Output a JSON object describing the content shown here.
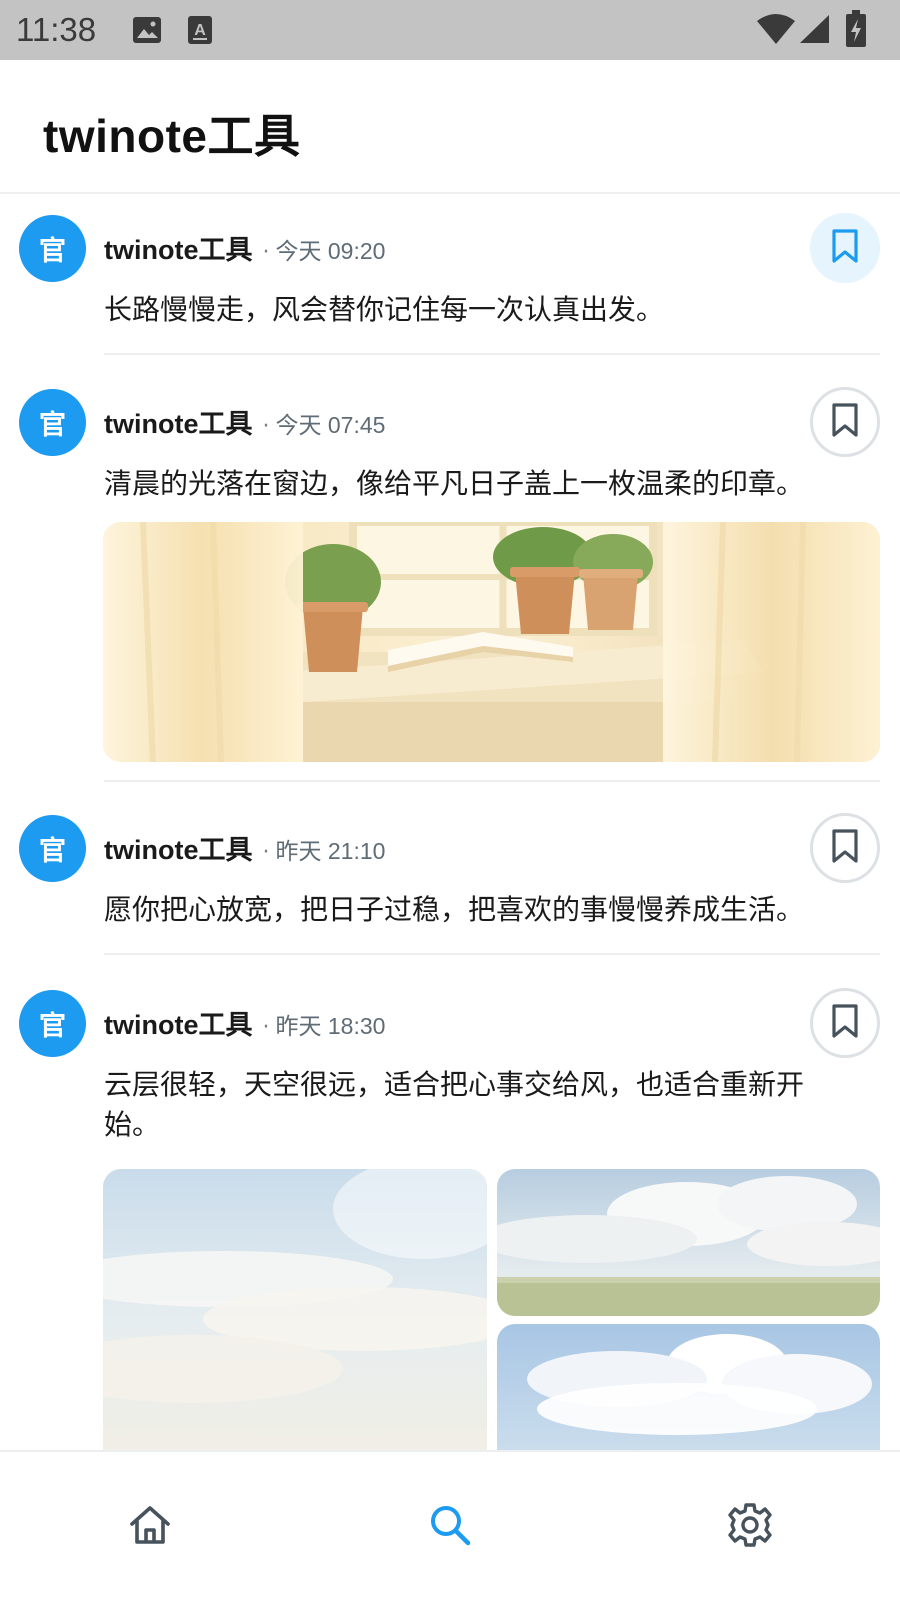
{
  "status_bar": {
    "time": "11:38",
    "icons": [
      "image-icon",
      "a-icon",
      "wifi-icon",
      "signal-icon",
      "battery-icon"
    ]
  },
  "header": {
    "title": "twinote工具"
  },
  "colors": {
    "accent": "#1d9bf0",
    "bookmark_active_bg": "#e6f4fd",
    "meta_gray": "#5f6b75"
  },
  "posts": [
    {
      "avatar_text": "官",
      "author": "twinote工具",
      "separator": "·",
      "time": "今天 09:20",
      "text": "长路慢慢走，风会替你记住每一次认真出发。",
      "bookmarked": true
    },
    {
      "avatar_text": "官",
      "author": "twinote工具",
      "separator": "·",
      "time": "今天 07:45",
      "text": "清晨的光落在窗边，像给平凡日子盖上一枚温柔的印章。",
      "bookmarked": false
    },
    {
      "avatar_text": "官",
      "author": "twinote工具",
      "separator": "·",
      "time": "昨天 21:10",
      "text": "愿你把心放宽，把日子过稳，把喜欢的事慢慢养成生活。",
      "bookmarked": false
    },
    {
      "avatar_text": "官",
      "author": "twinote工具",
      "separator": "·",
      "time": "昨天 18:30",
      "text": "云层很轻，天空很远，适合把心事交给风，也适合重新开始。",
      "bookmarked": false
    }
  ],
  "bottom_nav": {
    "items": [
      {
        "icon": "home-icon",
        "active": false
      },
      {
        "icon": "search-icon",
        "active": true
      },
      {
        "icon": "gear-icon",
        "active": false
      }
    ]
  }
}
